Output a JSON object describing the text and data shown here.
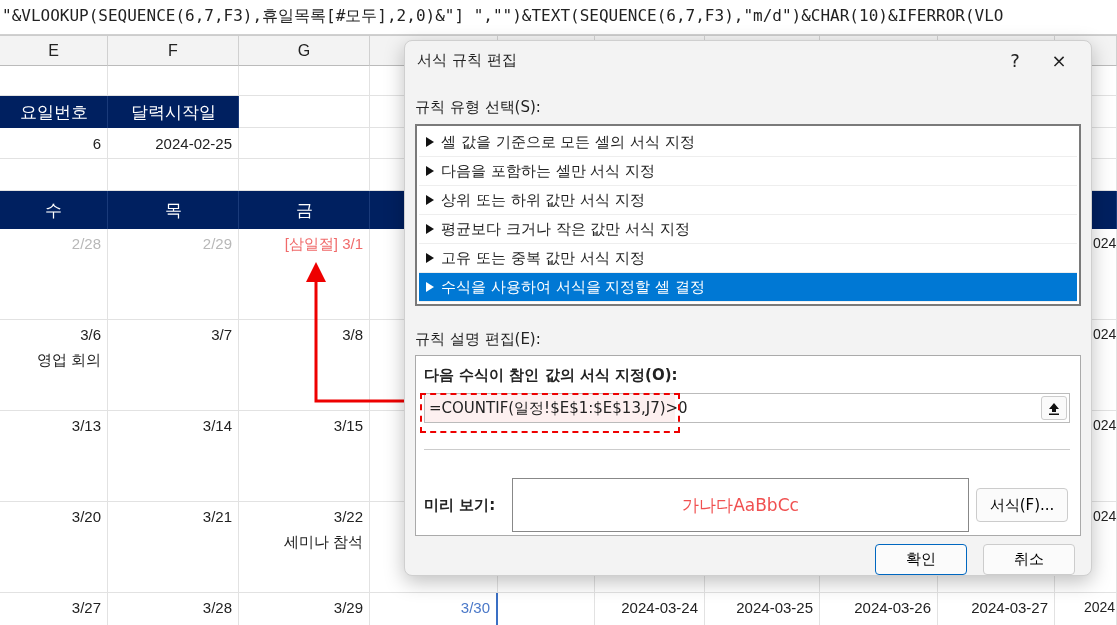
{
  "formula_bar": {
    "text": "\"&VLOOKUP(SEQUENCE(6,7,F3),휴일목록[#모두],2,0)&\"] \",\"\")&TEXT(SEQUENCE(6,7,F3),\"m/d\")&CHAR(10)&IFERROR(VLO"
  },
  "columns": [
    "E",
    "F",
    "G"
  ],
  "info_header": [
    "요일번호",
    "달력시작일"
  ],
  "info_values": [
    "6",
    "2024-02-25"
  ],
  "weekday_header": [
    "수",
    "목",
    "금"
  ],
  "weeks": [
    {
      "cells": [
        {
          "date": "2/28",
          "kind": "other_month"
        },
        {
          "date": "2/29",
          "kind": "other_month"
        },
        {
          "date": "[삼일절] 3/1",
          "kind": "holiday"
        }
      ],
      "far_cells": [
        "024"
      ]
    },
    {
      "cells": [
        {
          "date": "3/6",
          "event": "영업 회의",
          "kind": "normal"
        },
        {
          "date": "3/7",
          "kind": "normal"
        },
        {
          "date": "3/8",
          "kind": "normal"
        }
      ],
      "far_cells": [
        "024"
      ]
    },
    {
      "cells": [
        {
          "date": "3/13",
          "kind": "normal"
        },
        {
          "date": "3/14",
          "kind": "normal"
        },
        {
          "date": "3/15",
          "kind": "normal"
        }
      ],
      "far_cells": [
        "024"
      ]
    },
    {
      "cells": [
        {
          "date": "3/20",
          "kind": "normal"
        },
        {
          "date": "3/21",
          "kind": "normal"
        },
        {
          "date": "3/22",
          "event": "세미나 참석",
          "kind": "normal"
        }
      ],
      "far_cells": [
        "024"
      ]
    },
    {
      "cells": [
        {
          "date": "3/27",
          "kind": "normal"
        },
        {
          "date": "3/28",
          "kind": "normal"
        },
        {
          "date": "3/29",
          "kind": "normal"
        },
        {
          "date": "3/30",
          "kind": "saturday"
        }
      ],
      "far_cells": [
        "2024-03-24",
        "2024-03-25",
        "2024-03-26",
        "2024-03-27",
        "2024"
      ]
    }
  ],
  "dialog": {
    "title": "서식 규칙 편집",
    "help": "?",
    "close": "×",
    "rule_type_label": "규칙 유형 선택(S):",
    "rule_types": [
      {
        "label": "셀 값을 기준으로 모든 셀의 서식 지정",
        "selected": false
      },
      {
        "label": "다음을 포함하는 셀만 서식 지정",
        "selected": false
      },
      {
        "label": "상위 또는 하위 값만 서식 지정",
        "selected": false
      },
      {
        "label": "평균보다 크거나 작은 값만 서식 지정",
        "selected": false
      },
      {
        "label": "고유 또는 중복 값만 서식 지정",
        "selected": false
      },
      {
        "label": "수식을 사용하여 서식을 지정할 셀 결정",
        "selected": true
      }
    ],
    "description_label": "규칙 설명 편집(E):",
    "formula_label": "다음 수식이 참인 값의 서식 지정(O):",
    "formula": "=COUNTIF(일정!$E$1:$E$13,J7)>0",
    "preview_label": "미리 보기:",
    "preview_text": "가나다AaBbCc",
    "format_button": "서식(F)...",
    "buttons": [
      "확인",
      "취소"
    ]
  }
}
